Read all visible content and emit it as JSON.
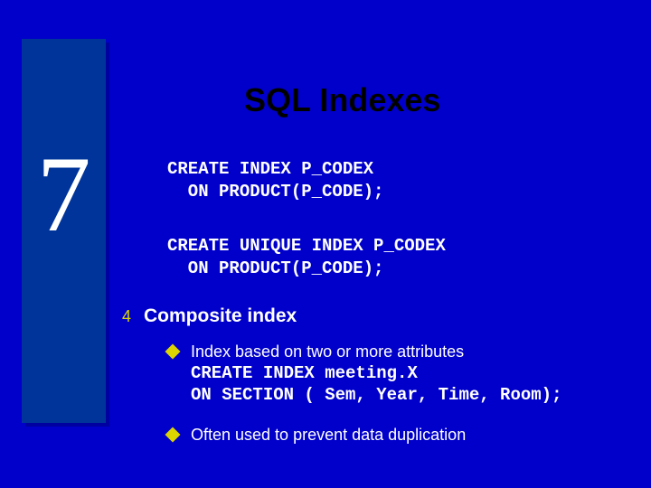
{
  "slide": {
    "chapter_number": "7",
    "title": "SQL Indexes",
    "code_block_1": "CREATE INDEX P_CODEX\n  ON PRODUCT(P_CODE);",
    "code_block_2": "CREATE UNIQUE INDEX P_CODEX\n  ON PRODUCT(P_CODE);",
    "bullet_main": {
      "icon": "4",
      "text": "Composite index"
    },
    "sub_bullets": [
      {
        "intro": "Index based on two or more attributes",
        "code": "CREATE INDEX meeting.X\nON SECTION ( Sem, Year, Time, Room);"
      },
      {
        "intro": "Often used to prevent data duplication",
        "code": ""
      }
    ]
  }
}
